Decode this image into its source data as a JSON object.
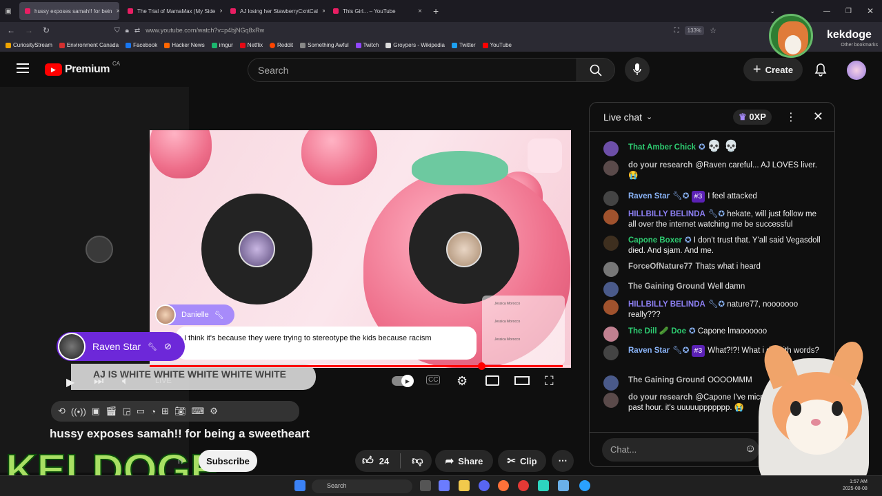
{
  "browser": {
    "tabs": [
      {
        "label": "hussy exposes samah!! for bein",
        "active": true
      },
      {
        "label": "The Trial of MamaMax (My Side",
        "active": false
      },
      {
        "label": "AJ losing her StawberryCxntCal",
        "active": false
      },
      {
        "label": "This Girl... – YouTube",
        "active": false
      }
    ],
    "url": "www.youtube.com/watch?v=p4bjNGq8xRw",
    "zoom": "133%",
    "bookmarks": [
      "CuriosityStream",
      "Environment Canada",
      "Facebook",
      "Hacker News",
      "imgur",
      "Netflix",
      "Reddit",
      "Something Awful",
      "Twitch",
      "Groypers - Wikipedia",
      "Twitter",
      "YouTube"
    ],
    "other_bookmarks": "Other bookmarks"
  },
  "youtube": {
    "logo": "Premium",
    "region": "CA",
    "search_placeholder": "Search",
    "create_label": "Create"
  },
  "video": {
    "danielle_label": "Danielle",
    "caption": "I think it's because they were trying to stereotype the kids because racism",
    "raven_label": "Raven Star",
    "banner": "AJ IS WHITE WHITE WHITE WHITE WHITE",
    "live_label": "LIVE",
    "progress": 0.98,
    "side_chat": [
      "Jessica Morocco",
      "Jessica Morocco",
      "Jessica Morocco"
    ]
  },
  "title": "hussy exposes samah!! for being a sweetheart",
  "subscribe_label": "Subscribe",
  "partial_channel_label": "n",
  "like_count": "24",
  "share_label": "Share",
  "clip_label": "Clip",
  "overlay": {
    "streamer_name": "kekdoge",
    "keldoge_logo": "KELDOGE"
  },
  "chat": {
    "header": "Live chat",
    "xp": "0XP",
    "input_placeholder": "Chat...",
    "messages": [
      {
        "name": "That Amber Chick",
        "color": "green",
        "text": "💀 💀"
      },
      {
        "name": "do your research",
        "color": "gray",
        "text": "@Raven careful... AJ LOVES liver. 😭"
      },
      {
        "name": "Raven Star",
        "color": "blue",
        "badge": "#3",
        "text": "I feel attacked"
      },
      {
        "name": "HILLBILLY BELINDA",
        "color": "purple",
        "text": "hekate, will just follow me all over the internet watching me be successful"
      },
      {
        "name": "Capone Boxer",
        "color": "green",
        "text": "I don't trust that. Y'all said Vegasdoll died. And sjam. And me."
      },
      {
        "name": "ForceOfNature77",
        "color": "gray",
        "text": "Thats what i heard"
      },
      {
        "name": "The Gaining Ground",
        "color": "gray",
        "text": "Well damn"
      },
      {
        "name": "HILLBILLY BELINDA",
        "color": "purple",
        "text": "nature77, nooooooo really???"
      },
      {
        "name": "The Dill 🥒 Doe",
        "color": "green",
        "text": "Capone lmaoooooo"
      },
      {
        "name": "Raven Star",
        "color": "blue",
        "badge": "#3",
        "text": "What?!?! What i do with words?"
      },
      {
        "name": "The Gaining Ground",
        "color": "gray",
        "text": "OOOOMMM"
      },
      {
        "name": "do your research",
        "color": "gray",
        "text": "@Capone I've microwave for the past hour. it's uuuuuppppppp. 😭"
      }
    ]
  },
  "taskbar": {
    "search_placeholder": "Search",
    "time": "1:57 AM",
    "date": "2025-08-08"
  }
}
